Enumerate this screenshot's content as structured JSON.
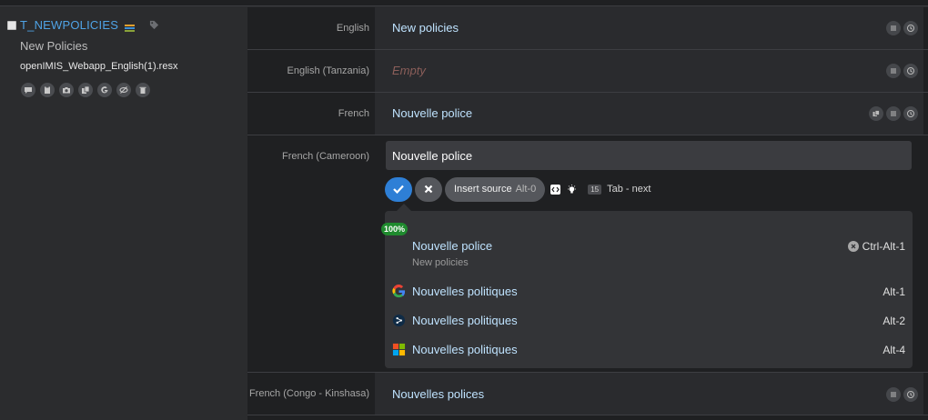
{
  "key": {
    "name": "T_NEWPOLICIES",
    "source_text": "New Policies",
    "file": "openIMIS_Webapp_English(1).resx"
  },
  "tools": [
    "comment-icon",
    "clipboard-icon",
    "camera-icon",
    "copy-icon",
    "google-icon",
    "hide-icon",
    "trash-icon"
  ],
  "rows": [
    {
      "lang": "English",
      "value": "New policies"
    },
    {
      "lang": "English (Tanzania)",
      "value": "Empty"
    },
    {
      "lang": "French",
      "value": "Nouvelle police"
    },
    {
      "lang": "French (Cameroon)",
      "value": "Nouvelle police"
    },
    {
      "lang": "French (Congo - Kinshasa)",
      "value": "Nouvelles polices"
    }
  ],
  "editor": {
    "insert_source": "Insert source",
    "insert_hotkey": "Alt-0",
    "count": "15",
    "tab_next": "Tab - next"
  },
  "suggestions": {
    "match_badge": "100%",
    "tm": {
      "text": "Nouvelle police",
      "source": "New policies",
      "hotkey": "Ctrl-Alt-1"
    },
    "mt": [
      {
        "service": "google-icon",
        "text": "Nouvelles politiques",
        "hotkey": "Alt-1"
      },
      {
        "service": "deepl-icon",
        "text": "Nouvelles politiques",
        "hotkey": "Alt-2"
      },
      {
        "service": "microsoft-icon",
        "text": "Nouvelles politiques",
        "hotkey": "Alt-4"
      }
    ]
  },
  "colors": {
    "accent": "#2e7fd6",
    "link": "#4fa3e6",
    "match": "#1f8a2e"
  }
}
